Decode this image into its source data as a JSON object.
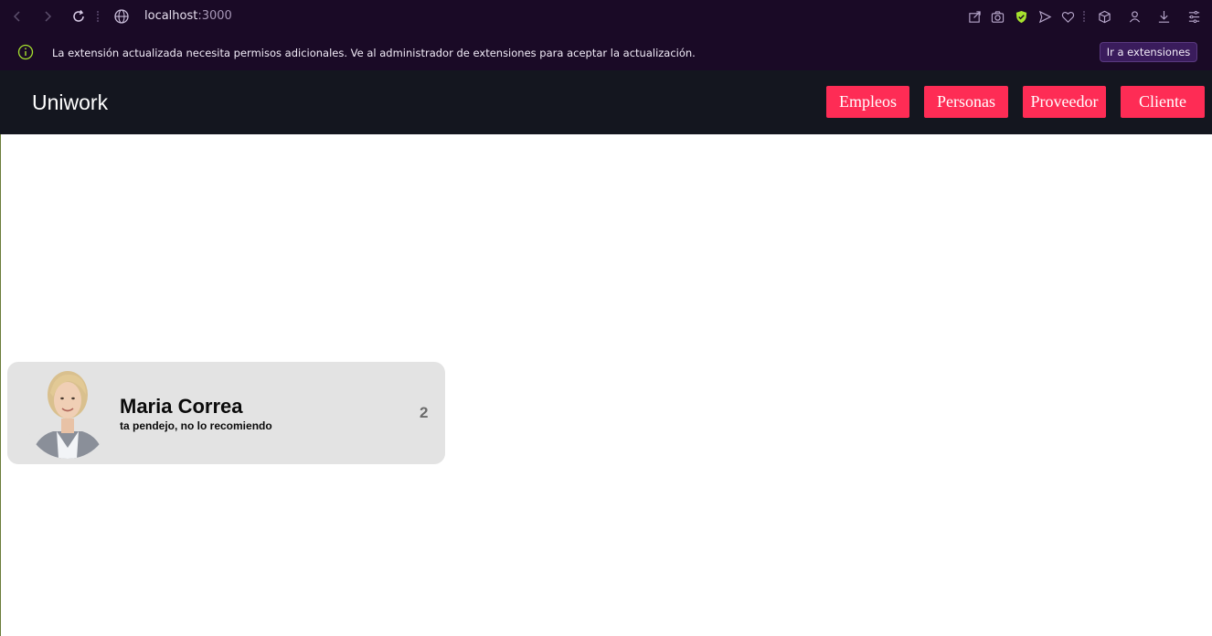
{
  "browser": {
    "url_host": "localhost",
    "url_port": ":3000"
  },
  "banner": {
    "message": "La extensión actualizada necesita permisos adicionales. Ve al administrador de extensiones para aceptar la actualización.",
    "button_label": "Ir a extensiones"
  },
  "header": {
    "brand": "Uniwork",
    "nav": [
      "Empleos",
      "Personas",
      "Proveedor",
      "Cliente"
    ]
  },
  "card": {
    "name": "Maria Correa",
    "description": "ta pendejo, no lo recomiendo",
    "count": "2"
  },
  "colors": {
    "accent": "#fe2c55",
    "header_bg": "#14161f",
    "browser_bg": "#1a0a26",
    "card_bg": "#e3e3e3"
  }
}
